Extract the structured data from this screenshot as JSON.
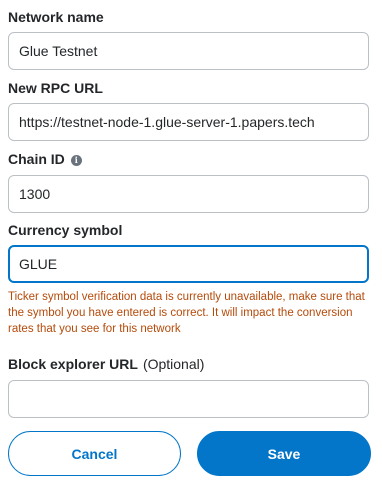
{
  "form": {
    "network_name": {
      "label": "Network name",
      "value": "Glue Testnet"
    },
    "rpc_url": {
      "label": "New RPC URL",
      "value": "https://testnet-node-1.glue-server-1.papers.tech"
    },
    "chain_id": {
      "label": "Chain ID",
      "info_icon": "info-icon",
      "value": "1300"
    },
    "currency_symbol": {
      "label": "Currency symbol",
      "value": "GLUE",
      "warning": "Ticker symbol verification data is currently unavailable, make sure that the symbol you have entered is correct. It will impact the conversion rates that you see for this network"
    },
    "block_explorer": {
      "label": "Block explorer URL",
      "optional_label": "(Optional)",
      "value": ""
    }
  },
  "actions": {
    "cancel_label": "Cancel",
    "save_label": "Save"
  },
  "colors": {
    "primary": "#0376c9",
    "warning_text": "#b54b0b",
    "border": "#bbc0c5",
    "text": "#24272a"
  }
}
